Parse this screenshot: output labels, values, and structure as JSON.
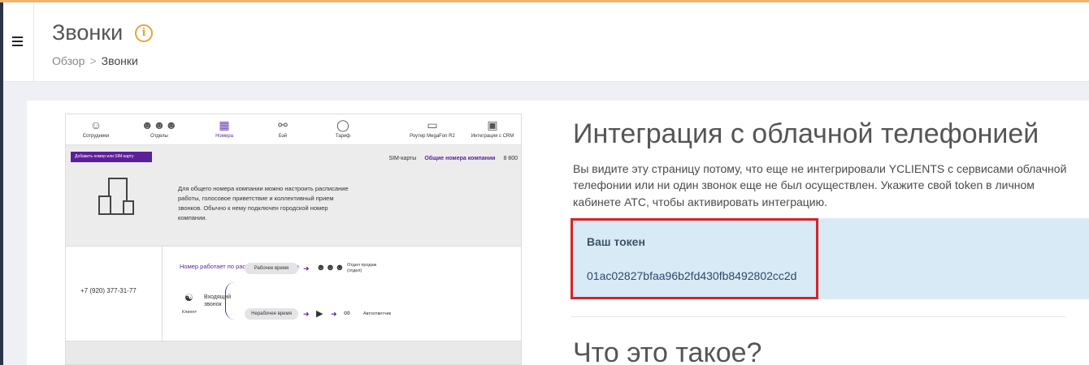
{
  "header": {
    "title": "Звонки",
    "info_icon_glyph": "i",
    "breadcrumb": {
      "root": "Обзор",
      "separator": ">",
      "current": "Звонки"
    }
  },
  "screenshot": {
    "nav": [
      {
        "label": "Сотрудники",
        "icon": "user-icon"
      },
      {
        "label": "Отделы",
        "icon": "team-icon"
      },
      {
        "label": "Номера",
        "icon": "sim-icon",
        "active": true
      },
      {
        "label": "Бэй",
        "icon": "nodes-icon"
      },
      {
        "label": "Тариф",
        "icon": "tariff-icon"
      },
      {
        "label": "Роутер MegaFon R2",
        "icon": "router-icon"
      },
      {
        "label": "Интеграция с CRM",
        "icon": "crm-icon"
      }
    ],
    "add_button": "Добавить номер или SIM-карту",
    "tabs": [
      "SIM-карты",
      "Общие номера компании",
      "8 800"
    ],
    "description": "Для общего номера компании можно настроить расписание работы, голосовое приветствие и коллективный прием звонков. Обычно к нему подключен городской номер компании.",
    "phone": "+7 (920) 377-31-77",
    "schedule": "Номер работает по расписанию компании",
    "incoming": "Входящий звонок",
    "client": "Клиент",
    "work_time": "Рабочее время",
    "off_time": "Нерабочее время",
    "sales_dept": "Отдел продаж (отдел)",
    "autoanswer": "Автоответчик"
  },
  "integration": {
    "title": "Интеграция с облачной телефонией",
    "description": "Вы видите эту страницу потому, что еще не интегрировали YCLIENTS с сервисами облачной телефонии или ни один звонок еще не был осуществлен. Укажите свой token в личном кабинете АТС, чтобы активировать интеграцию.",
    "token_label": "Ваш токен",
    "token_value": "01ac02827bfaa96b2fd430fb8492802cc2d"
  },
  "faq": {
    "title": "Что это такое?"
  },
  "colors": {
    "accent": "#e8a53a",
    "highlight": "#d8222a",
    "token_bg": "#d8eaf5",
    "brand_purple": "#5c1f99"
  }
}
